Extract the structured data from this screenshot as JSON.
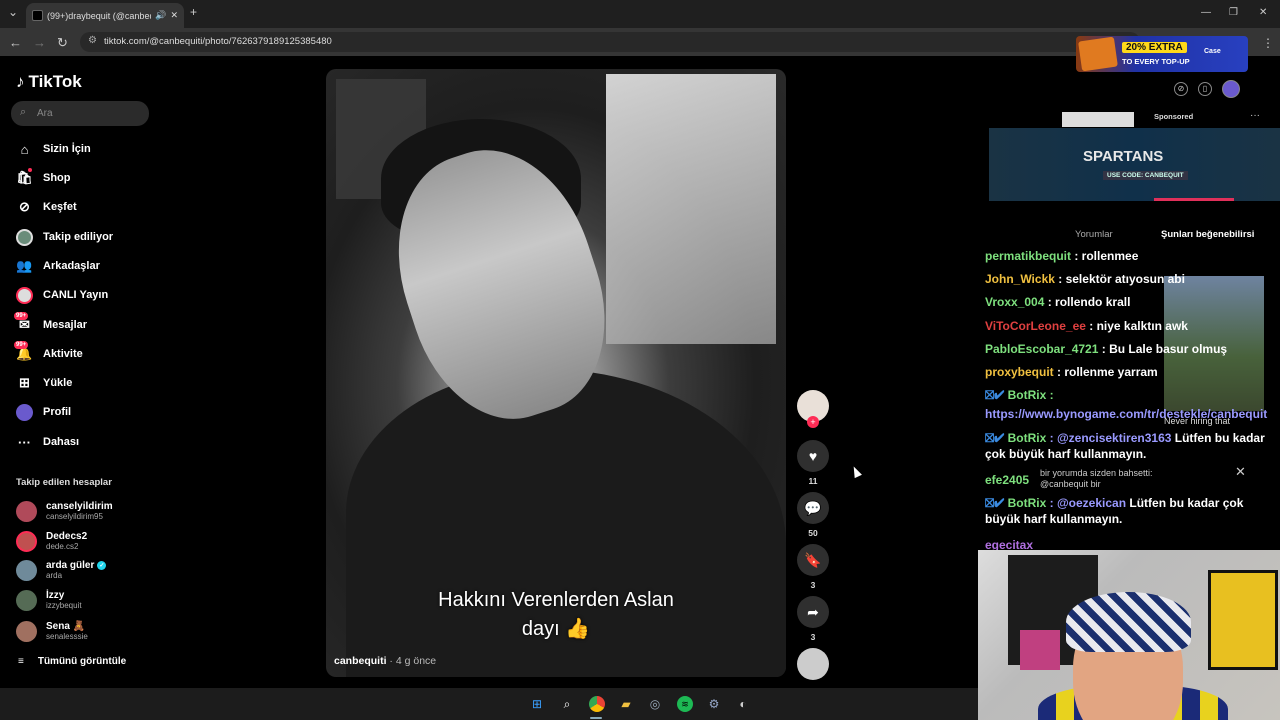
{
  "browser": {
    "tab_title": "(99+)draybequit (@canbeq",
    "url": "tiktok.com/@canbequiti/photo/7626379189125385480",
    "promo": {
      "headline": "20% EXTRA",
      "subline": "TO EVERY TOP-UP",
      "brand": "Case"
    }
  },
  "tiktok": {
    "logo": "TikTok",
    "search_placeholder": "Ara",
    "nav": [
      {
        "label": "Sizin İçin",
        "icon": "home-icon"
      },
      {
        "label": "Shop",
        "icon": "shop-bag-icon"
      },
      {
        "label": "Keşfet",
        "icon": "compass-icon"
      },
      {
        "label": "Takip ediliyor",
        "icon": "avatar"
      },
      {
        "label": "Arkadaşlar",
        "icon": "friends-icon"
      },
      {
        "label": "CANLI Yayın",
        "icon": "avatar"
      },
      {
        "label": "Mesajlar",
        "icon": "message-icon",
        "badge": "99+"
      },
      {
        "label": "Aktivite",
        "icon": "activity-icon",
        "badge": "99+"
      },
      {
        "label": "Yükle",
        "icon": "upload-icon"
      },
      {
        "label": "Profil",
        "icon": "avatar"
      },
      {
        "label": "Dahası",
        "icon": "more-icon"
      }
    ],
    "following_header": "Takip edilen hesaplar",
    "following": [
      {
        "name": "canselyildirim",
        "user": "canselyildirim95",
        "verified": false
      },
      {
        "name": "Dedecs2",
        "user": "dede.cs2",
        "verified": false
      },
      {
        "name": "arda güler",
        "user": "arda",
        "verified": true
      },
      {
        "name": "İzzy",
        "user": "izzybequit",
        "verified": false
      },
      {
        "name": "Sena 🧸",
        "user": "senalesssie",
        "verified": false
      }
    ],
    "see_all": "Tümünü görüntüle",
    "post": {
      "caption_line1": "Hakkını Verenlerden Aslan",
      "caption_line2": "dayı 👍",
      "author": "canbequiti",
      "age": " · 4 g önce"
    },
    "actions": {
      "likes": "11",
      "comments": "50",
      "saves": "3",
      "shares": "3"
    }
  },
  "overlay": {
    "sponsored": "Sponsored",
    "banner_title": "SPARTANS",
    "banner_code": "USE CODE: CANBEQUIT",
    "tabs": [
      "Yorumlar",
      "Şunları beğenebilirsi"
    ],
    "chat": [
      {
        "user": "permatikbequit",
        "msg": " : rollenmee",
        "color": "#7ee07e"
      },
      {
        "user": "John_Wickk",
        "msg": " : selektör atıyosun abi",
        "color": "#f0c040"
      },
      {
        "user": "Vroxx_004",
        "msg": " : rollendo krall",
        "color": "#7ee07e"
      },
      {
        "user": "ViToCorLeone_ee",
        "msg": " : niye kalktın awk",
        "color": "#e04040"
      },
      {
        "user": "PabloEscobar_4721",
        "msg": " : Bu Lale basur olmuş",
        "color": "#7ee07e"
      },
      {
        "user": "proxybequit",
        "msg": " : rollenme yarram",
        "color": "#f0c040"
      }
    ],
    "bot1_user": "BotRix :",
    "bot1_link": "https://www.bynogame.com/tr/destekle/canbequit",
    "bot2_user": "BotRix",
    "bot2_mention": " : @zencisektiren3163",
    "bot2_msg": " Lütfen bu kadar çok büyük harf kullanmayın.",
    "efe": "efe2405",
    "bot3_user": "BotRix",
    "bot3_mention": " : @oezekican",
    "bot3_msg": " Lütfen bu kadar çok büyük harf kullanmayın.",
    "last": "egecitax",
    "notif": "bir yorumda sizden bahsetti: @canbequit bir",
    "hiring": "Never hiring that"
  },
  "colors": {
    "accent": "#fe2c55",
    "verified": "#20d5ec"
  }
}
